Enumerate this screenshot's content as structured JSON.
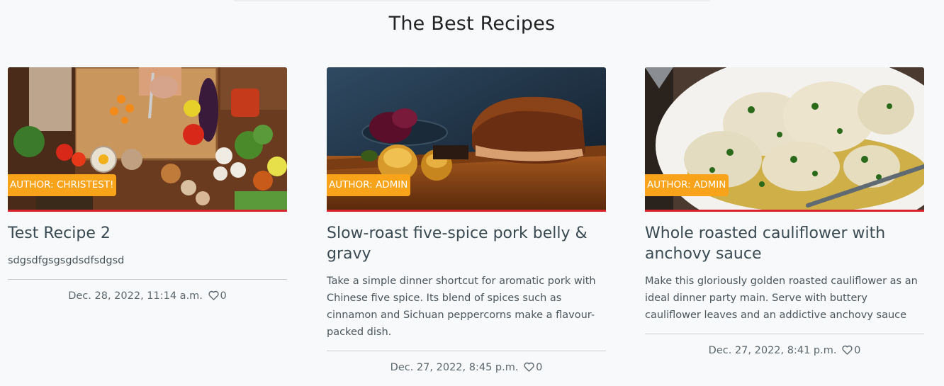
{
  "page": {
    "title": "The Best Recipes"
  },
  "recipes": [
    {
      "author": "AUTHOR: CHRISTEST!",
      "title": "Test Recipe 2",
      "description": "sdgsdfgsgsgdsdfsdgsd",
      "date": "Dec. 28, 2022, 11:14 a.m.",
      "likes": "0",
      "image_icon": "chopping-board-vegetables-photo"
    },
    {
      "author": "AUTHOR: ADMIN",
      "title": "Slow-roast five-spice pork belly & gravy",
      "description": "Take a simple dinner shortcut for aromatic pork with Chinese five spice. Its blend of spices such as cinnamon and Sichuan peppercorns make a flavour-packed dish.",
      "date": "Dec. 27, 2022, 8:45 p.m.",
      "likes": "0",
      "image_icon": "roast-pork-photo"
    },
    {
      "author": "AUTHOR: ADMIN",
      "title": "Whole roasted cauliflower with anchovy sauce",
      "description": "Make this gloriously golden roasted cauliflower as an ideal dinner party main. Serve with buttery cauliflower leaves and an addictive anchovy sauce",
      "date": "Dec. 27, 2022, 8:41 p.m.",
      "likes": "0",
      "image_icon": "roasted-cauliflower-photo"
    }
  ],
  "colors": {
    "badge": "#f9a31a",
    "accent_border": "#d9232d",
    "background": "#f8f9fa"
  }
}
